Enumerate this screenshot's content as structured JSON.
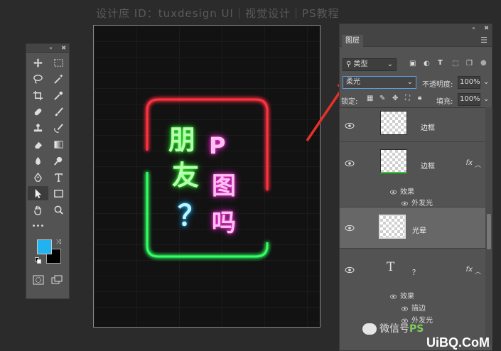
{
  "watermark": "设计庶 ID：tuxdesign    UI｜视觉设计｜PS教程",
  "tools_panel": {
    "collapse_label": "«",
    "close_label": "✖",
    "more_label": "•••"
  },
  "colors": {
    "foreground": "#22b2f0",
    "background": "#000000"
  },
  "canvas_text": {
    "word1": "朋",
    "word2": "友",
    "q": "？",
    "p": "P",
    "tu": "图",
    "ma": "吗"
  },
  "layers_panel": {
    "tab": "图层",
    "filter_kind": "类型",
    "blend_mode": "柔光",
    "opacity_label": "不透明度:",
    "opacity_value": "100%",
    "lock_label": "锁定:",
    "fill_label": "填充:",
    "fill_value": "100%",
    "layers": [
      {
        "name": "边框"
      },
      {
        "name": "边框",
        "fx": "fx",
        "effects_label": "效果",
        "effects": [
          "外发光"
        ]
      },
      {
        "name": "光晕"
      },
      {
        "name": "？",
        "fx": "fx",
        "effects_label": "效果",
        "effects": [
          "描边",
          "外发光"
        ]
      }
    ]
  },
  "footer": {
    "wechat": "微信号",
    "brand": "PS",
    "site": "UiBQ.CoM"
  }
}
